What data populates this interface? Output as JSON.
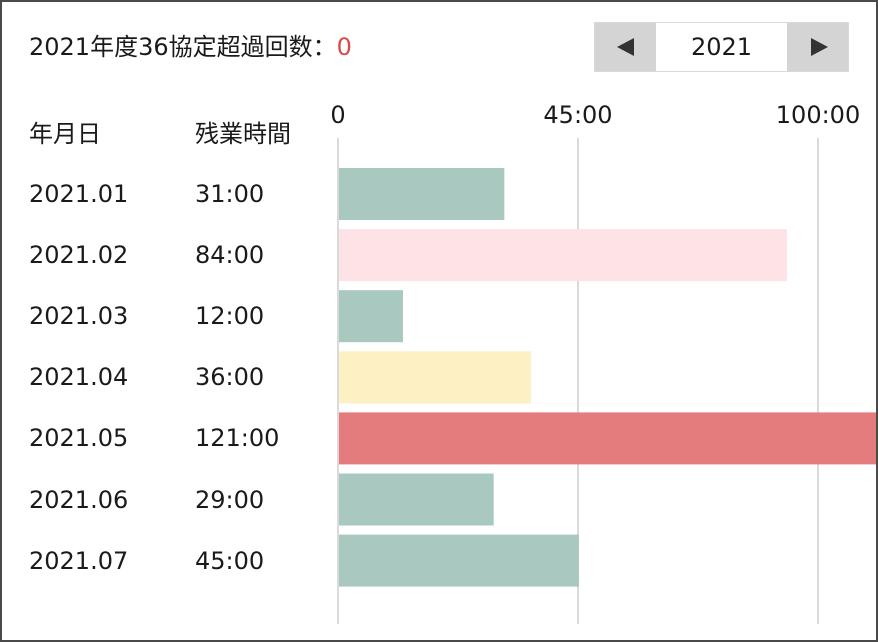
{
  "header": {
    "title": "2021年度36協定超過回数：",
    "exceed_count": "0"
  },
  "year_picker": {
    "prev_icon": "triangle-left-icon",
    "next_icon": "triangle-right-icon",
    "year": "2021"
  },
  "columns": {
    "date": "年月日",
    "hours": "残業時間"
  },
  "colors": {
    "normal": "#a8c8c0",
    "light_pink": "#fde3e5",
    "yellow": "#fdf0c2",
    "red": "#e47b7d",
    "grid": "#b5b5b5"
  },
  "chart_data": {
    "type": "bar",
    "orientation": "horizontal",
    "categories": [
      "2021.01",
      "2021.02",
      "2021.03",
      "2021.04",
      "2021.05",
      "2021.06",
      "2021.07"
    ],
    "labels": [
      "31:00",
      "84:00",
      "12:00",
      "36:00",
      "121:00",
      "29:00",
      "45:00"
    ],
    "values": [
      31,
      84,
      12,
      36,
      121,
      29,
      45
    ],
    "bar_colors": [
      "#a8c8c0",
      "#fde3e5",
      "#a8c8c0",
      "#fdf0c2",
      "#e47b7d",
      "#a8c8c0",
      "#a8c8c0"
    ],
    "ticks": [
      {
        "value": 0,
        "label": "0"
      },
      {
        "value": 45,
        "label": "45:00"
      },
      {
        "value": 90,
        "label": "100:00"
      }
    ],
    "grid": true
  }
}
